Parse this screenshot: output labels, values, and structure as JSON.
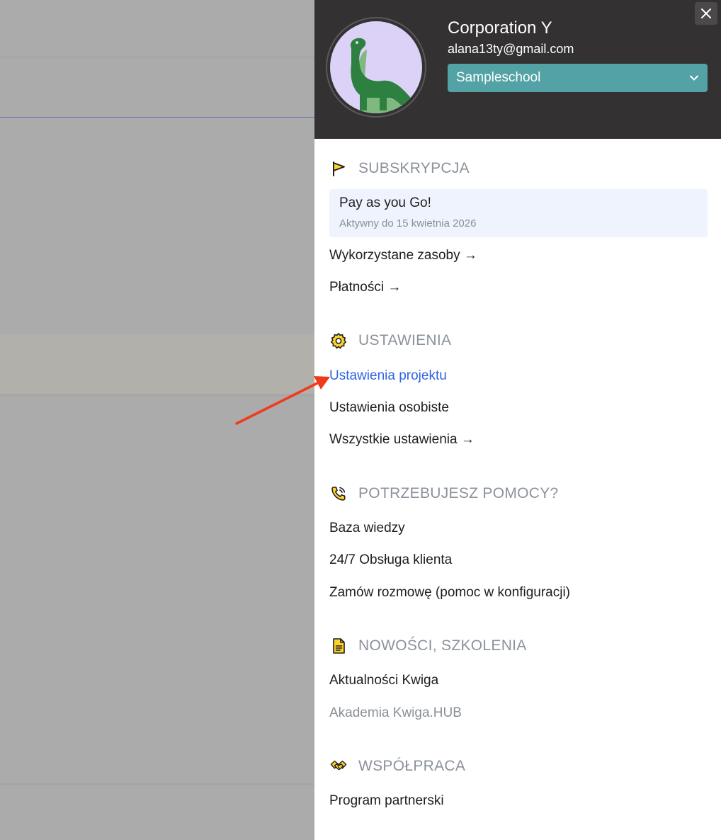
{
  "profile": {
    "org_name": "Corporation Y",
    "email": "alana13ty@gmail.com",
    "school_selected": "Sampleschool"
  },
  "sections": {
    "subscription": {
      "title": "SUBSKRYPCJA",
      "plan_name": "Pay as you Go!",
      "plan_status": "Aktywny do 15 kwietnia 2026",
      "links": [
        "Wykorzystane zasoby →",
        "Płatności →"
      ]
    },
    "settings": {
      "title": "USTAWIENIA",
      "links": [
        "Ustawienia projektu",
        "Ustawienia osobiste",
        "Wszystkie ustawienia →"
      ]
    },
    "help": {
      "title": "POTRZEBUJESZ POMOCY?",
      "links": [
        "Baza wiedzy",
        "24/7 Obsługa klienta",
        "Zamów rozmowę (pomoc w konfiguracji)"
      ]
    },
    "news": {
      "title": "NOWOŚCI, SZKOLENIA",
      "links": [
        "Aktualności Kwiga",
        "Akademia Kwiga.HUB"
      ]
    },
    "partnership": {
      "title": "WSPÓŁPRACA",
      "links": [
        "Program partnerski"
      ]
    }
  },
  "icons": {
    "close": "close-icon",
    "select": "chevron-down-icon",
    "subscription": "flag-icon",
    "settings": "gear-icon",
    "help": "phone-icon",
    "news": "document-icon",
    "partnership": "handshake-icon",
    "avatar": "dinosaur-icon",
    "annotation": "red-arrow-icon"
  },
  "colors": {
    "header_bg": "#333132",
    "select_bg": "#53a2a5",
    "active_link": "#2f64e2",
    "section_title": "#8c929b",
    "plan_card_bg": "#eef3fd",
    "icon_accent": "#ffd42a",
    "annotation_arrow": "#f03a1e"
  }
}
